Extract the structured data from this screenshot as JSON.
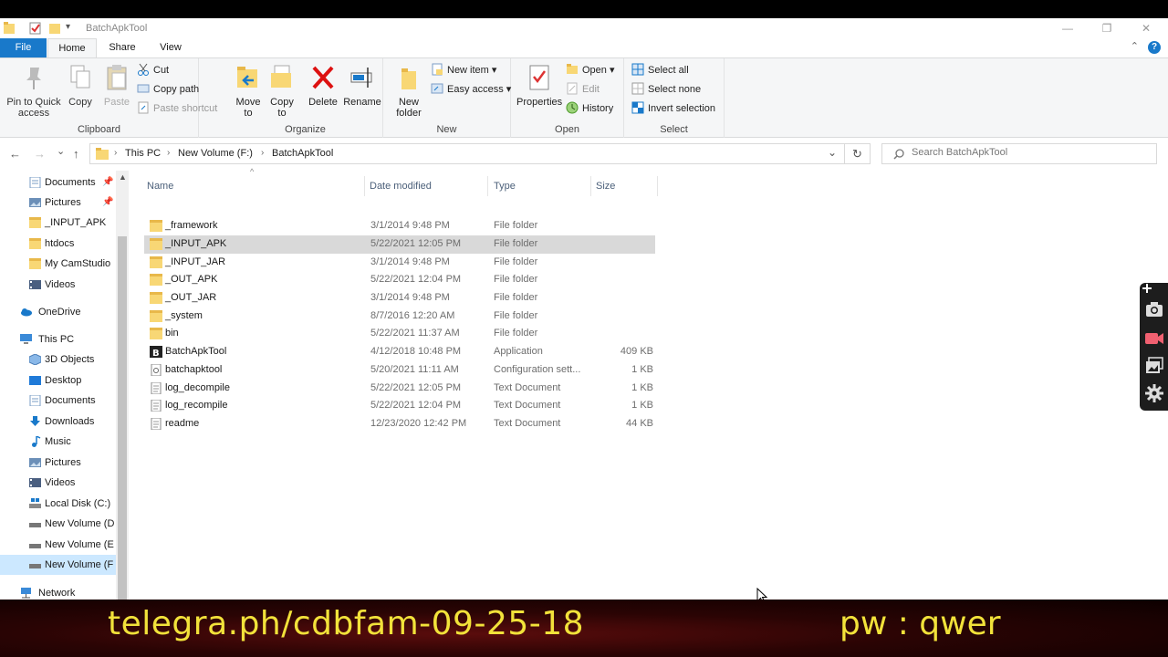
{
  "window": {
    "title": "BatchApkTool",
    "minimize": "—",
    "restore": "❐",
    "close": "✕"
  },
  "tabs": {
    "file": "File",
    "home": "Home",
    "share": "Share",
    "view": "View",
    "help": "?",
    "collapse": "⌃"
  },
  "ribbon": {
    "clipboard": {
      "label": "Clipboard",
      "pin": "Pin to Quick access",
      "copy": "Copy",
      "paste": "Paste",
      "cut": "Cut",
      "copy_path": "Copy path",
      "paste_shortcut": "Paste shortcut"
    },
    "organize": {
      "label": "Organize",
      "move_to": "Move to",
      "copy_to": "Copy to",
      "delete": "Delete",
      "rename": "Rename"
    },
    "new": {
      "label": "New",
      "new_folder": "New folder",
      "new_item": "New item ▾",
      "easy_access": "Easy access ▾"
    },
    "open": {
      "label": "Open",
      "properties": "Properties",
      "open": "Open ▾",
      "edit": "Edit",
      "history": "History"
    },
    "select": {
      "label": "Select",
      "select_all": "Select all",
      "select_none": "Select none",
      "invert": "Invert selection"
    }
  },
  "address": {
    "back": "←",
    "forward": "→",
    "recent": "⌄",
    "up": "↑",
    "crumbs": [
      "This PC",
      "New Volume (F:)",
      "BatchApkTool"
    ],
    "sep": "›",
    "dropdown": "⌄",
    "refresh": "↻",
    "search_placeholder": "Search BatchApkTool"
  },
  "nav": [
    {
      "label": "Documents",
      "pinned": "📌"
    },
    {
      "label": "Pictures",
      "pinned": "📌"
    },
    {
      "label": "_INPUT_APK"
    },
    {
      "label": "htdocs"
    },
    {
      "label": "My CamStudio"
    },
    {
      "label": "Videos"
    },
    {
      "label": "OneDrive"
    },
    {
      "label": "This PC"
    },
    {
      "label": "3D Objects"
    },
    {
      "label": "Desktop"
    },
    {
      "label": "Documents"
    },
    {
      "label": "Downloads"
    },
    {
      "label": "Music"
    },
    {
      "label": "Pictures"
    },
    {
      "label": "Videos"
    },
    {
      "label": "Local Disk (C:)"
    },
    {
      "label": "New Volume (D"
    },
    {
      "label": "New Volume (E"
    },
    {
      "label": "New Volume (F"
    },
    {
      "label": "Network"
    }
  ],
  "columns": {
    "name": "Name",
    "date": "Date modified",
    "type": "Type",
    "size": "Size",
    "sort_arrow": "^"
  },
  "files": [
    {
      "name": "_framework",
      "date": "3/1/2014 9:48 PM",
      "type": "File folder",
      "size": ""
    },
    {
      "name": "_INPUT_APK",
      "date": "5/22/2021 12:05 PM",
      "type": "File folder",
      "size": ""
    },
    {
      "name": "_INPUT_JAR",
      "date": "3/1/2014 9:48 PM",
      "type": "File folder",
      "size": ""
    },
    {
      "name": "_OUT_APK",
      "date": "5/22/2021 12:04 PM",
      "type": "File folder",
      "size": ""
    },
    {
      "name": "_OUT_JAR",
      "date": "3/1/2014 9:48 PM",
      "type": "File folder",
      "size": ""
    },
    {
      "name": "_system",
      "date": "8/7/2016 12:20 AM",
      "type": "File folder",
      "size": ""
    },
    {
      "name": "bin",
      "date": "5/22/2021 11:37 AM",
      "type": "File folder",
      "size": ""
    },
    {
      "name": "BatchApkTool",
      "date": "4/12/2018 10:48 PM",
      "type": "Application",
      "size": "409 KB"
    },
    {
      "name": "batchapktool",
      "date": "5/20/2021 11:11 AM",
      "type": "Configuration sett...",
      "size": "1 KB"
    },
    {
      "name": "log_decompile",
      "date": "5/22/2021 12:05 PM",
      "type": "Text Document",
      "size": "1 KB"
    },
    {
      "name": "log_recompile",
      "date": "5/22/2021 12:04 PM",
      "type": "Text Document",
      "size": "1 KB"
    },
    {
      "name": "readme",
      "date": "12/23/2020 12:42 PM",
      "type": "Text Document",
      "size": "44 KB"
    }
  ],
  "banner": {
    "link": "telegra.ph/cdbfam-09-25-18",
    "password": "pw : qwer"
  },
  "colors": {
    "accent": "#1979ca",
    "selection": "#d9d9d9",
    "nav_selection": "#cce8ff",
    "folder": "#f8d775",
    "banner_text": "#f2e23a"
  }
}
